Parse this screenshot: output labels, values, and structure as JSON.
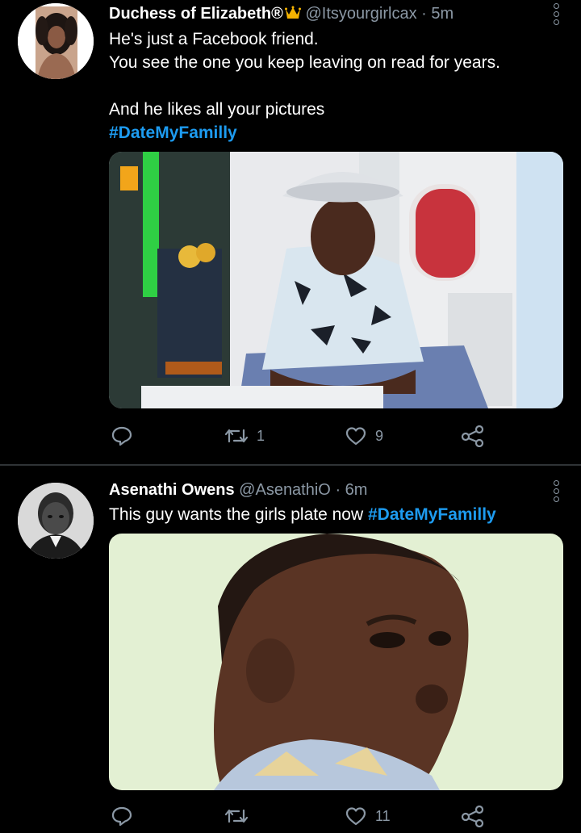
{
  "tweets": [
    {
      "name": "Duchess of Elizabeth®",
      "handle": "@Itsyourgirlcax",
      "separator": "·",
      "time": "5m",
      "lines": [
        "He's just a Facebook friend.",
        "You see the one you keep leaving on read for years.",
        "",
        "And he likes all your pictures"
      ],
      "hashtag": "#DateMyFamilly",
      "reply_count": "",
      "retweet_count": "1",
      "like_count": "9"
    },
    {
      "name": "Asenathi Owens",
      "handle": "@AsenathiO",
      "separator": "·",
      "time": "6m",
      "text": "This guy wants the girls plate now ",
      "hashtag": "#DateMyFamilly",
      "reply_count": "",
      "retweet_count": "",
      "like_count": "11"
    }
  ],
  "colors": {
    "background": "#000000",
    "text": "#ffffff",
    "secondary": "#8b98a5",
    "accent": "#1d9bf0",
    "divider": "#2f3336"
  },
  "icons": [
    "crown-emoji-icon",
    "more-vertical-icon",
    "reply-icon",
    "retweet-icon",
    "like-icon",
    "share-icon"
  ]
}
